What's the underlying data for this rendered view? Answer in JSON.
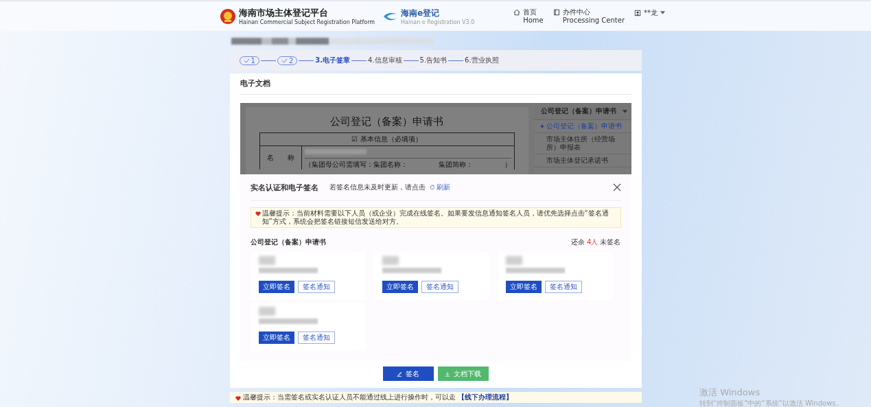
{
  "header": {
    "title": "海南市场主体登记平台",
    "subtitle": "Hainan Commercial Subject Registration Platform",
    "brand": "海南e登记",
    "brand_sub": "Hainan e Registration V3.0",
    "nav": [
      {
        "label": "首页",
        "sub": "Home",
        "kind": "home"
      },
      {
        "label": "办件中心",
        "sub": "Processing Center",
        "kind": "book"
      }
    ],
    "user": "**龙"
  },
  "steps": [
    {
      "label": "1",
      "done": true,
      "selected": false
    },
    {
      "label": "2",
      "done": true,
      "selected": false
    },
    {
      "label": "3.电子签章",
      "done": false,
      "selected": true
    },
    {
      "label": "4.信息审核",
      "done": false,
      "selected": false
    },
    {
      "label": "5.告知书",
      "done": false,
      "selected": false
    },
    {
      "label": "6.营业执照",
      "done": false,
      "selected": false
    }
  ],
  "section_title": "电子文档",
  "document": {
    "title": "公司登记（备案）申请书",
    "section": "☑ 基本信息（必填项）",
    "field_label": "名　　称",
    "hint": "（集团母公司需填写：集团名称：",
    "hint_2": "集团简称：",
    "hint_end": "）"
  },
  "doc_menu": {
    "header": "公司登记（备案）申请书",
    "items": [
      {
        "label": "公司登记（备案）申请书",
        "selected": true
      },
      {
        "label": "市场主体住所（经营场所）申报表",
        "selected": false
      },
      {
        "label": "市场主体登记承诺书",
        "selected": false
      }
    ]
  },
  "dialog": {
    "title": "实名认证和电子签名",
    "refresh_hint": "若签名信息未及时更新，请点击",
    "refresh_label": "刷新",
    "notice": "温馨提示：当前材料需要以下人员（或企业）完成在线签名。如果要发信息通知签名人员，请优先选择点击“签名通知”方式，系统会把签名链接短信发送给对方。",
    "doc_name": "公司登记（备案）申请书",
    "remaining_prefix": "还余",
    "remaining_count": "4人",
    "remaining_suffix": "未签名",
    "signers": [
      {
        "sign_label": "立即签名",
        "notify_label": "签名通知"
      },
      {
        "sign_label": "立即签名",
        "notify_label": "签名通知"
      },
      {
        "sign_label": "立即签名",
        "notify_label": "签名通知"
      },
      {
        "sign_label": "立即签名",
        "notify_label": "签名通知"
      }
    ]
  },
  "actions": [
    {
      "label": "签名",
      "kind": "sign"
    },
    {
      "label": "文档下载",
      "kind": "download"
    }
  ],
  "bottom_notice": {
    "text": "温馨提示：当需签名或实名认证人员不能通过线上进行操作时，可以走",
    "link": "【线下办理流程】"
  },
  "activation": {
    "title": "激活 Windows",
    "text": "转到“控制面板”中的“系统”以激活 Windows。"
  }
}
